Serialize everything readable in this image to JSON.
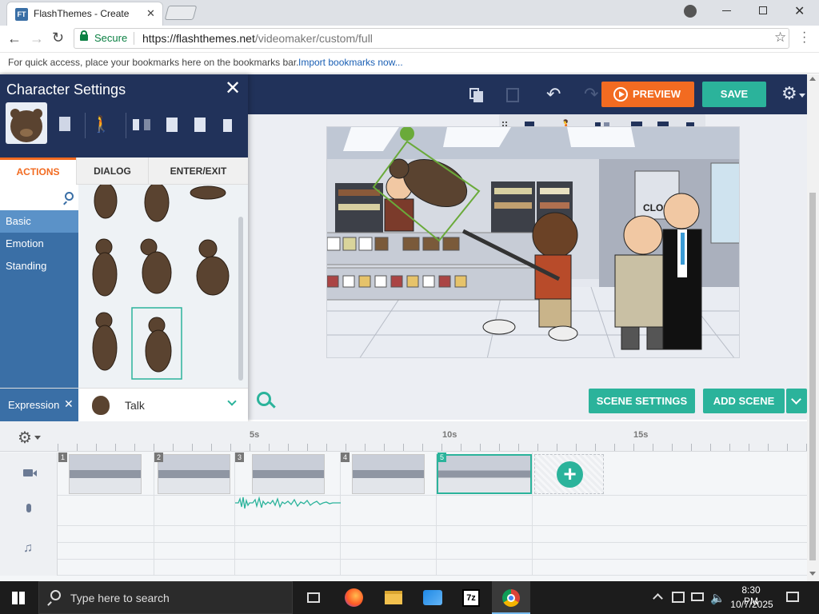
{
  "browser": {
    "tab_title": "FlashThemes - Create",
    "tab_close": "✕",
    "secure_label": "Secure",
    "url_prefix": "https://flashthemes.net",
    "url_path": "/videomaker/custom/full",
    "bookmarks_hint": "For quick access, place your bookmarks here on the bookmarks bar.",
    "bookmarks_link": "Import bookmarks now..."
  },
  "toolbar": {
    "preview_label": "PREVIEW",
    "save_label": "SAVE"
  },
  "character_settings": {
    "title": "Character Settings",
    "tabs": [
      "ACTIONS",
      "DIALOG",
      "ENTER/EXIT"
    ],
    "active_tab": "ACTIONS",
    "categories": [
      "Basic",
      "Emotion",
      "Standing"
    ],
    "selected_category": "Basic",
    "expression_label": "Expression",
    "expression_value": "Talk"
  },
  "stage": {
    "store_sign": "CLOS"
  },
  "scene_buttons": {
    "scene_settings": "SCENE SETTINGS",
    "add_scene": "ADD SCENE"
  },
  "timeline": {
    "ruler_labels": [
      "5s",
      "10s",
      "15s"
    ],
    "scene_numbers": [
      "1",
      "2",
      "3",
      "4",
      "5"
    ],
    "selected_scene": "5"
  },
  "taskbar": {
    "search_placeholder": "Type here to search",
    "time": "8:30 PM",
    "date": "10/7/2025"
  },
  "colors": {
    "navy": "#21325a",
    "orange": "#f26b21",
    "teal": "#2bb39b",
    "category_blue": "#3a6fa6"
  }
}
